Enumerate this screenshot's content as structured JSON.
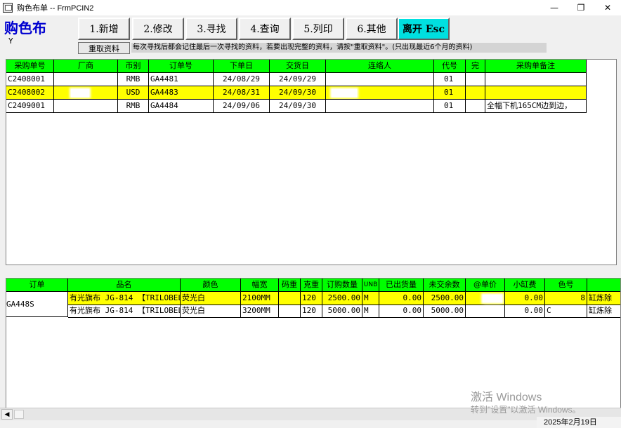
{
  "window": {
    "title": "购色布单  --  FrmPCIN2",
    "minimize": "—",
    "restore": "❐",
    "close": "✕"
  },
  "header": {
    "big_title": "购色布",
    "sub": "Y"
  },
  "toolbar": {
    "new": "1.新增",
    "edit": "2.修改",
    "find": "3.寻找",
    "query": "4.查询",
    "print": "5.列印",
    "other": "6.其他",
    "exit": "离开 Esc"
  },
  "refresh": {
    "label": "重取资料",
    "hint": "每次寻找后都会记住最后一次寻找的资料，若要出现完整的资料，请按\"重取资料\"。(只出现最近6个月的资料)"
  },
  "po_grid": {
    "headers": [
      "采购单号",
      "厂商",
      "币别",
      "订单号",
      "下单日",
      "交货日",
      "连络人",
      "代号",
      "完",
      "采购单备注"
    ],
    "rows": [
      {
        "po": "C2408001",
        "vendor": "",
        "currency": "RMB",
        "order": "GA4481",
        "order_date": "24/08/29",
        "delivery": "24/09/29",
        "contact": "",
        "code": "01",
        "done": "",
        "remark": ""
      },
      {
        "po": "C2408002",
        "vendor": "",
        "currency": "USD",
        "order": "GA4483",
        "order_date": "24/08/31",
        "delivery": "24/09/30",
        "contact": "",
        "code": "01",
        "done": "",
        "remark": ""
      },
      {
        "po": "C2409001",
        "vendor": "",
        "currency": "RMB",
        "order": "GA4484",
        "order_date": "24/09/06",
        "delivery": "24/09/30",
        "contact": "",
        "code": "01",
        "done": "",
        "remark": "全幅下机165CM边到边，"
      }
    ]
  },
  "detail_grid": {
    "headers": [
      "订单",
      "品名",
      "颜色",
      "幅宽",
      "码重",
      "克重",
      "订购数量",
      "UNB",
      "已出货量",
      "未交余数",
      "@单价",
      "小缸费",
      "色号",
      ""
    ],
    "order_no": "GA448S",
    "rows": [
      {
        "name": "有光旗布 JG-814 【TRILOBEL",
        "color": "荧光白",
        "width": "2100MM",
        "yard_wt": "",
        "gsm": "120",
        "qty": "2500.00",
        "unit": "M",
        "shipped": "0.00",
        "remain": "2500.00",
        "price": "",
        "dye_fee": "0.00",
        "color_no": "8",
        "note": "缸炼除"
      },
      {
        "name": "有光旗布 JG-814 【TRILOBEL",
        "color": "荧光白",
        "width": "3200MM",
        "yard_wt": "",
        "gsm": "120",
        "qty": "5000.00",
        "unit": "M",
        "shipped": "0.00",
        "remain": "5000.00",
        "price": "",
        "dye_fee": "0.00",
        "color_no": "C",
        "note": "缸炼除"
      }
    ]
  },
  "scrollbar": {
    "left_arrow": "◀"
  },
  "watermark": {
    "line1": "激活 Windows",
    "line2": "转到\"设置\"以激活 Windows。"
  },
  "taskbar": {
    "date": "2025年2月19日"
  }
}
